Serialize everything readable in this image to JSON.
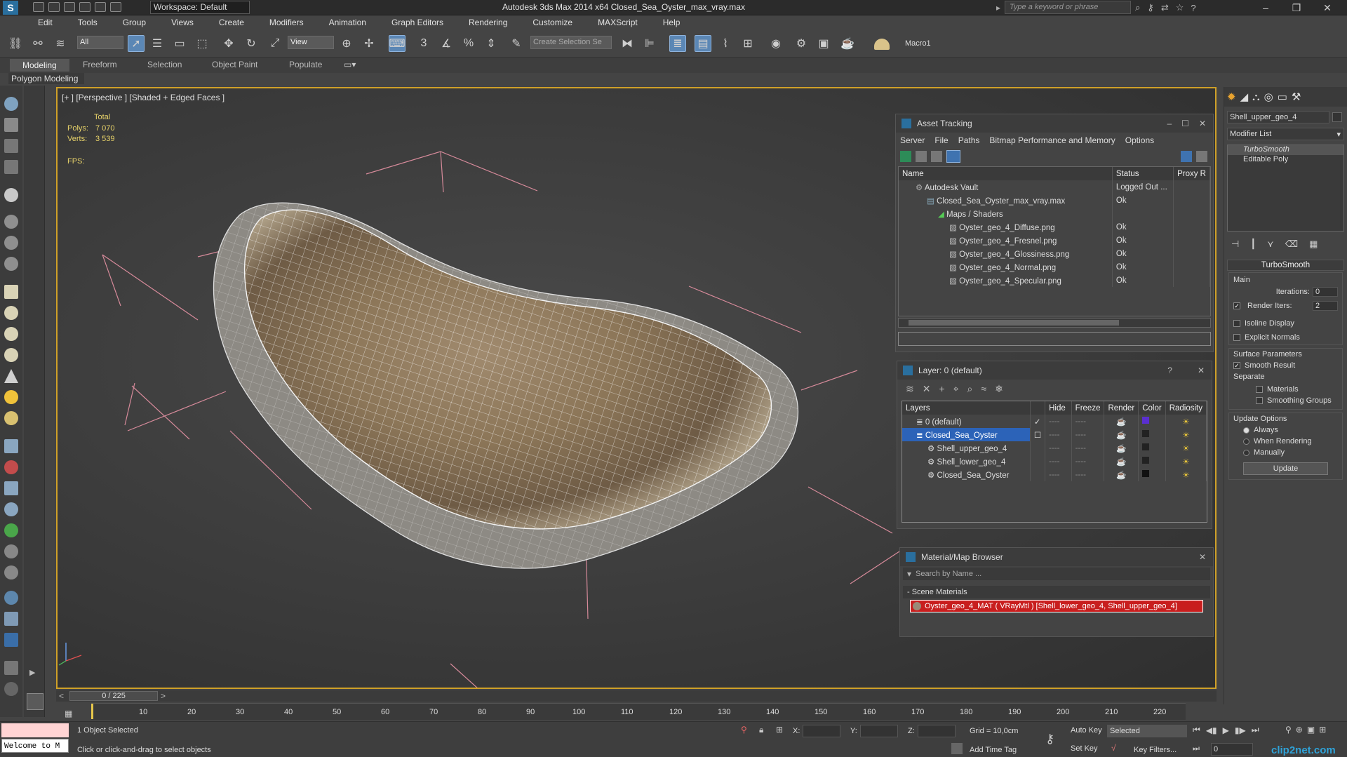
{
  "titlebar": {
    "logo": "S",
    "workspace": "Workspace: Default",
    "title": "Autodesk 3ds Max  2014 x64     Closed_Sea_Oyster_max_vray.max",
    "search_placeholder": "Type a keyword or phrase"
  },
  "menu": [
    "Edit",
    "Tools",
    "Group",
    "Views",
    "Create",
    "Modifiers",
    "Animation",
    "Graph Editors",
    "Rendering",
    "Customize",
    "MAXScript",
    "Help"
  ],
  "toolbar": {
    "filter": "All",
    "refcoord": "View",
    "selset_placeholder": "Create Selection Se",
    "macro": "Macro1"
  },
  "ribbon": {
    "tabs": [
      "Modeling",
      "Freeform",
      "Selection",
      "Object Paint",
      "Populate"
    ],
    "active": "Modeling",
    "sub": "Polygon Modeling"
  },
  "viewport": {
    "label": "[+ ] [Perspective ] [Shaded + Edged Faces ]",
    "stats_total": "Total",
    "polys_label": "Polys:",
    "polys": "7 070",
    "verts_label": "Verts:",
    "verts": "3 539",
    "fps_label": "FPS:"
  },
  "asset_tracking": {
    "title": "Asset Tracking",
    "menu": [
      "Server",
      "File",
      "Paths",
      "Bitmap Performance and Memory",
      "Options"
    ],
    "columns": [
      "Name",
      "Status",
      "Proxy R"
    ],
    "rows": [
      {
        "name": "Autodesk Vault",
        "status": "Logged Out ..."
      },
      {
        "name": "Closed_Sea_Oyster_max_vray.max",
        "status": "Ok"
      },
      {
        "name": "Maps / Shaders",
        "status": ""
      },
      {
        "name": "Oyster_geo_4_Diffuse.png",
        "status": "Ok"
      },
      {
        "name": "Oyster_geo_4_Fresnel.png",
        "status": "Ok"
      },
      {
        "name": "Oyster_geo_4_Glossiness.png",
        "status": "Ok"
      },
      {
        "name": "Oyster_geo_4_Normal.png",
        "status": "Ok"
      },
      {
        "name": "Oyster_geo_4_Specular.png",
        "status": "Ok"
      }
    ]
  },
  "layers": {
    "title": "Layer: 0 (default)",
    "help": "?",
    "columns": [
      "Layers",
      "Hide",
      "Freeze",
      "Render",
      "Color",
      "Radiosity"
    ],
    "rows": [
      {
        "name": "0 (default)",
        "color": "#5a2fd0"
      },
      {
        "name": "Closed_Sea_Oyster",
        "color": "#222222"
      },
      {
        "name": "Shell_upper_geo_4",
        "color": "#222222"
      },
      {
        "name": "Shell_lower_geo_4",
        "color": "#222222"
      },
      {
        "name": "Closed_Sea_Oyster",
        "color": "#111111"
      }
    ]
  },
  "material_browser": {
    "title": "Material/Map Browser",
    "search_placeholder": "Search by Name ...",
    "group": "- Scene Materials",
    "item": "Oyster_geo_4_MAT ( VRayMtl ) [Shell_lower_geo_4, Shell_upper_geo_4]"
  },
  "command_panel": {
    "object_name": "Shell_upper_geo_4",
    "modifier_list": "Modifier List",
    "stack": [
      "TurboSmooth",
      "Editable Poly"
    ],
    "rollout": "TurboSmooth",
    "main": "Main",
    "iterations_label": "Iterations:",
    "iterations": "0",
    "render_iters_label": "Render Iters:",
    "render_iters": "2",
    "isoline": "Isoline Display",
    "explicit": "Explicit Normals",
    "surface": "Surface Parameters",
    "smooth_result": "Smooth Result",
    "separate": "Separate",
    "materials": "Materials",
    "smoothing_groups": "Smoothing Groups",
    "update_options": "Update Options",
    "always": "Always",
    "when_rendering": "When Rendering",
    "manually": "Manually",
    "update": "Update"
  },
  "timeline": {
    "frame": "0 / 225",
    "ticks": [
      "10",
      "20",
      "30",
      "40",
      "50",
      "60",
      "70",
      "80",
      "90",
      "100",
      "110",
      "120",
      "130",
      "140",
      "150",
      "160",
      "170",
      "180",
      "190",
      "200",
      "210",
      "220"
    ]
  },
  "status": {
    "welcome": "Welcome to M",
    "selected": "1 Object Selected",
    "prompt": "Click or click-and-drag to select objects",
    "x_label": "X:",
    "y_label": "Y:",
    "z_label": "Z:",
    "grid": "Grid = 10,0cm",
    "add_time_tag": "Add Time Tag",
    "auto_key": "Auto Key",
    "set_key": "Set Key",
    "selected_mode": "Selected",
    "key_filters": "Key Filters...",
    "frame_value": "0",
    "brand": "clip2net.com"
  }
}
